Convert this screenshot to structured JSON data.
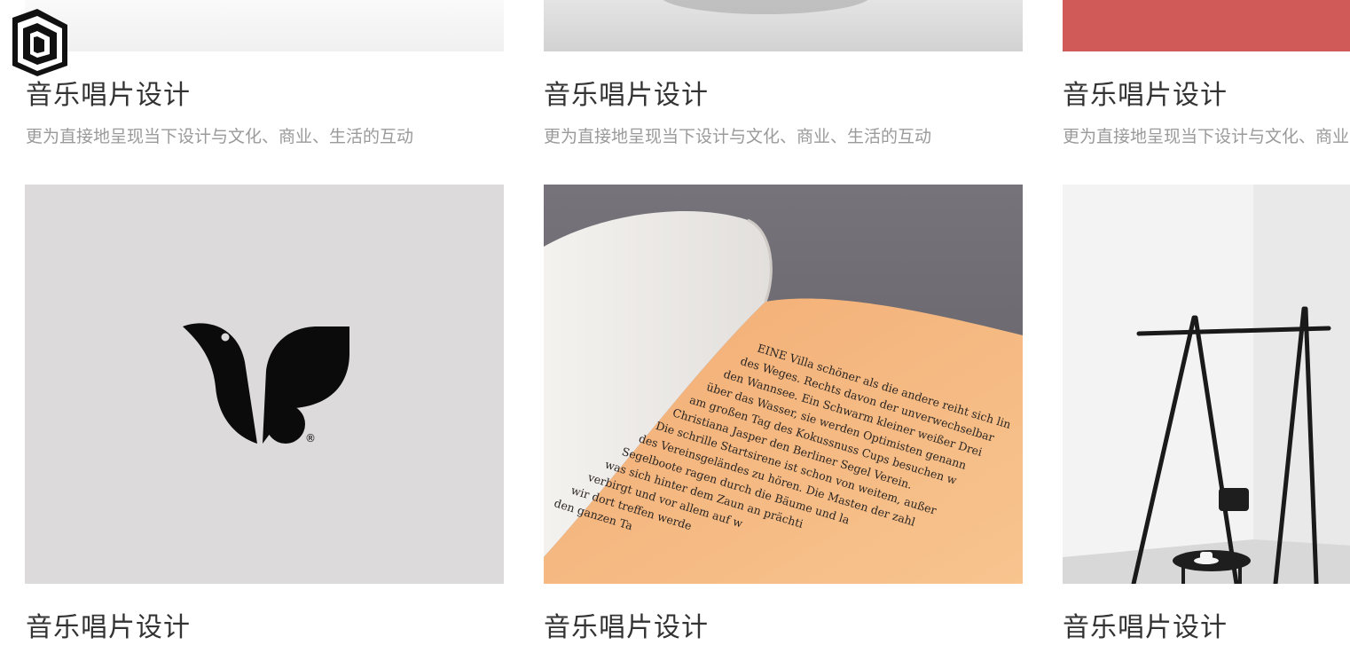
{
  "row1": [
    {
      "title": "音乐唱片设计",
      "desc": "更为直接地呈现当下设计与文化、商业、生活的互动"
    },
    {
      "title": "音乐唱片设计",
      "desc": "更为直接地呈现当下设计与文化、商业、生活的互动"
    },
    {
      "title": "音乐唱片设计",
      "desc": "更为直接地呈现当下设计与文化、商业、生活的互动"
    }
  ],
  "row2": [
    {
      "title": "音乐唱片设计"
    },
    {
      "title": "音乐唱片设计"
    },
    {
      "title": "音乐唱片设计"
    }
  ],
  "book_lines": [
    "EINE Villa schöner als die andere reiht sich lin",
    "des Weges. Rechts davon der unverwechselbar",
    "den Wannsee. Ein Schwarm kleiner weißer Drei",
    "über das Wasser, sie werden Optimisten genann",
    "am großen Tag des Kokussnuss Cups besuchen w",
    "Christiana Jasper den Berliner Segel Verein.",
    "Die schrille Startsirene ist schon von weitem, außer",
    "des Vereinsgeländes zu hören. Die Masten der zahl",
    "Segelboote ragen durch die Bäume und la",
    "was sich hinter dem Zaun an prächti",
    "verbirgt und vor allem auf w",
    "wir dort treffen werde",
    "den ganzen Ta"
  ],
  "registered_mark": "®",
  "colors": {
    "title": "#333333",
    "desc": "#9a9a9a",
    "red": "#d05a58",
    "grey_bg": "#dcdadb",
    "book_orange": "#f5b882",
    "book_bg": "#6e6c70"
  }
}
